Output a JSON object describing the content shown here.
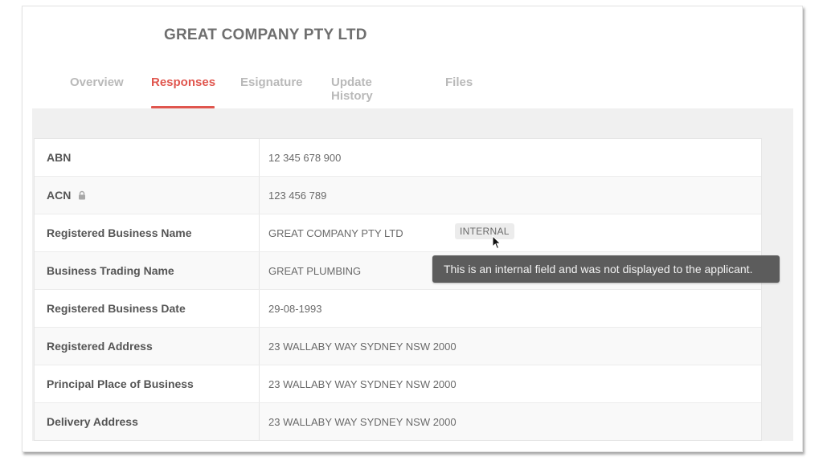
{
  "header": {
    "company_name": "GREAT COMPANY PTY LTD"
  },
  "tabs": [
    {
      "label": "Overview",
      "active": false
    },
    {
      "label": "Responses",
      "active": true
    },
    {
      "label": "Esignature",
      "active": false
    },
    {
      "label": "Update History",
      "active": false
    },
    {
      "label": "Files",
      "active": false
    }
  ],
  "fields": [
    {
      "label": "ABN",
      "value": "12 345 678 900"
    },
    {
      "label": "ACN",
      "value": "123 456 789",
      "locked": true,
      "icon": "lock-icon"
    },
    {
      "label": "Registered Business Name",
      "value": "GREAT COMPANY PTY LTD",
      "badge": "INTERNAL"
    },
    {
      "label": "Business Trading Name",
      "value": "GREAT PLUMBING"
    },
    {
      "label": "Registered Business Date",
      "value": "29-08-1993"
    },
    {
      "label": "Registered Address",
      "value": "23 WALLABY WAY SYDNEY NSW 2000"
    },
    {
      "label": "Principal Place of Business",
      "value": "23 WALLABY WAY SYDNEY NSW 2000"
    },
    {
      "label": "Delivery Address",
      "value": "23 WALLABY WAY SYDNEY NSW 2000"
    }
  ],
  "tooltip": {
    "text": "This is an internal field and was not displayed to the applicant."
  },
  "colors": {
    "accent": "#e0564e",
    "tooltip_bg": "#5c5c5c"
  }
}
